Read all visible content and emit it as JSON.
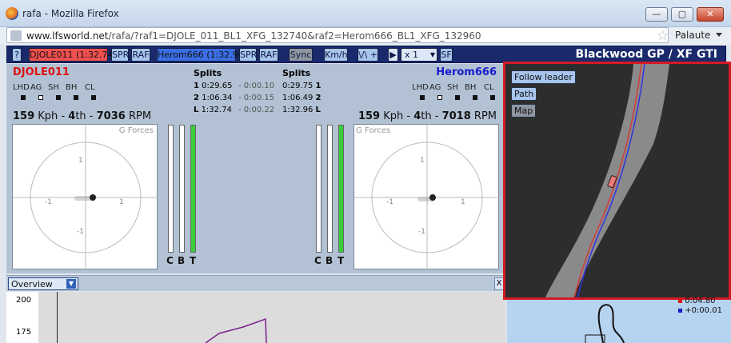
{
  "window": {
    "title": "rafa - Mozilla Firefox"
  },
  "nav": {
    "url_host": "www.lfsworld.net",
    "url_path": "/rafa/?raf1=DJOLE_011_BL1_XFG_132740&raf2=Herom666_BL1_XFG_132960",
    "profile": "Palaute"
  },
  "toolbar": {
    "help": "?",
    "driver1_label": "DJOLE011 (1:32.74)",
    "driver2_label": "Herom666 (1:32.96)",
    "spr": "SPR",
    "raf": "RAF",
    "sync": "Sync",
    "units": "Km/h",
    "view": "\\/\\ +",
    "speed": "x 1",
    "sf": "SF",
    "track_title": "Blackwood GP / XF GTI"
  },
  "driver1": {
    "name": "DJOLE011",
    "color": "#dd1111",
    "speed": "159",
    "gear": "4",
    "rpm": "7036"
  },
  "driver2": {
    "name": "Herom666",
    "color": "#1a1acc",
    "speed": "159",
    "gear": "4",
    "rpm": "7018"
  },
  "units": {
    "speed": "Kph",
    "gear_suffix": "th",
    "rpm": "RPM",
    "sep": " - "
  },
  "indicators": [
    "LHD",
    "AG",
    "SH",
    "BH",
    "CL"
  ],
  "splits": {
    "header": "Splits",
    "rows": [
      {
        "key": "1",
        "d1": "0:29.65",
        "delta": "- 0:00.10",
        "d2": "0:29.75"
      },
      {
        "key": "2",
        "d1": "1:06.34",
        "delta": "- 0:00.15",
        "d2": "1:06.49"
      },
      {
        "key": "L",
        "d1": "1:32.74",
        "delta": "- 0:00.22",
        "d2": "1:32.96"
      }
    ]
  },
  "gforces": {
    "label": "G Forces",
    "tick_pos": "1",
    "tick_neg": "-1"
  },
  "bars": {
    "labels": [
      "C",
      "B",
      "T"
    ],
    "d1_values": [
      0,
      0,
      1
    ],
    "d2_values": [
      0,
      0,
      1
    ]
  },
  "overview": {
    "selected": "Overview",
    "close": "X"
  },
  "chart_data": {
    "type": "line",
    "y_ticks": [
      "200",
      "175"
    ]
  },
  "map": {
    "follow_leader": "Follow leader",
    "path": "Path",
    "map": "Map"
  },
  "legend": {
    "l1": "0:04.80",
    "l2": "+0:00.01"
  },
  "colors": {
    "toolbar_bg": "#19296b",
    "red_frame": "#d41a25",
    "driver1_btn": "#f05050",
    "driver2_btn": "#3b6ee6"
  }
}
